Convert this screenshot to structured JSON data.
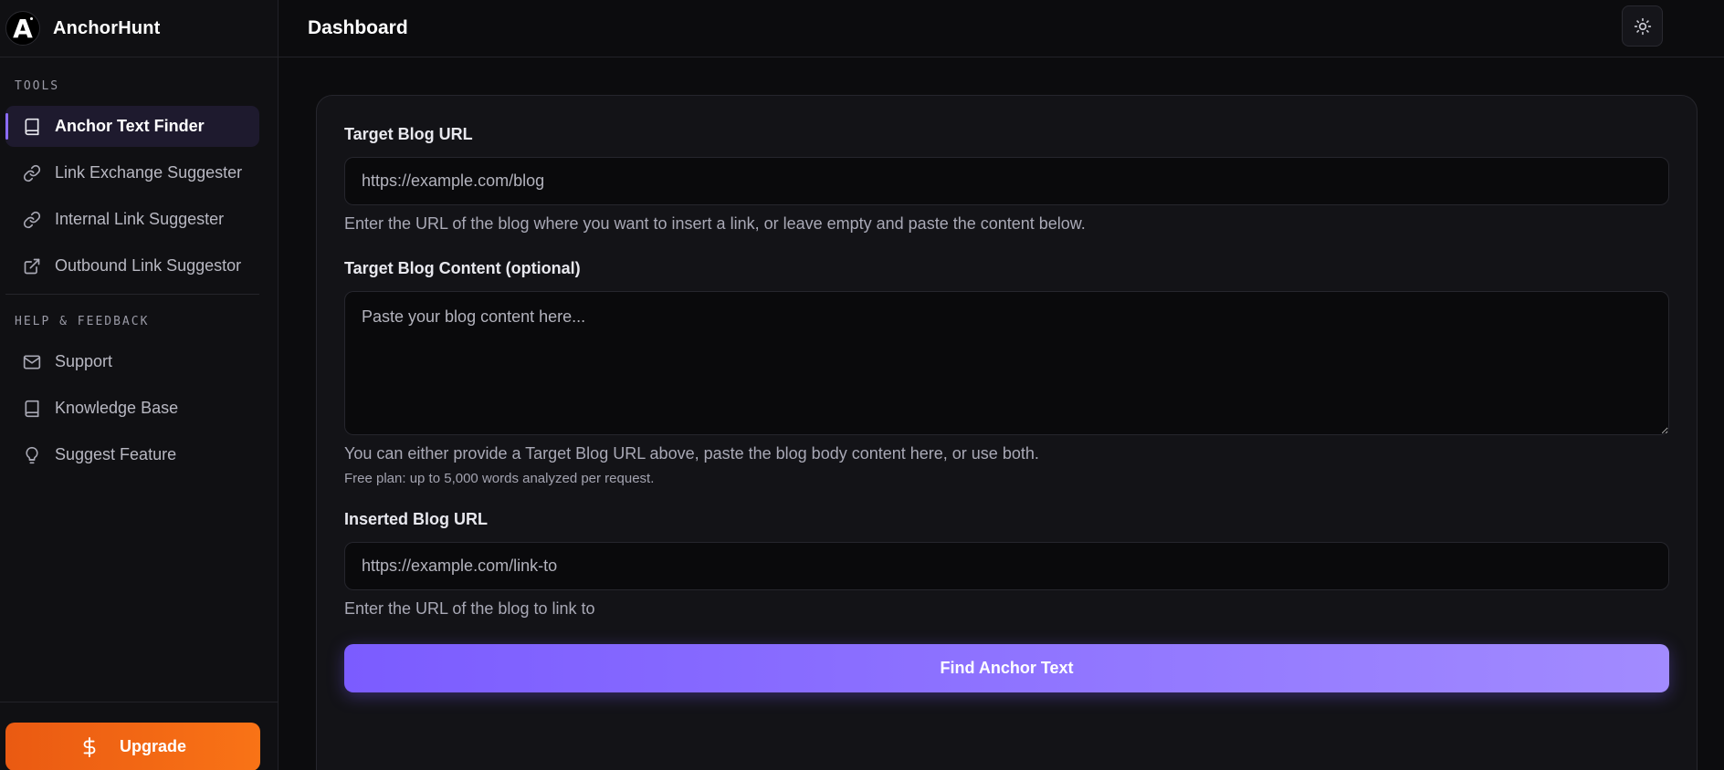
{
  "brand": {
    "logo_letter": "A",
    "name": "AnchorHunt"
  },
  "sidebar": {
    "tools_label": "TOOLS",
    "tools": [
      {
        "label": "Anchor Text Finder",
        "icon": "book-icon",
        "active": true
      },
      {
        "label": "Link Exchange Suggester",
        "icon": "link-icon",
        "active": false
      },
      {
        "label": "Internal Link Suggester",
        "icon": "link-icon",
        "active": false
      },
      {
        "label": "Outbound Link Suggestor",
        "icon": "external-link-icon",
        "active": false
      }
    ],
    "help_label": "HELP & FEEDBACK",
    "help": [
      {
        "label": "Support",
        "icon": "mail-icon"
      },
      {
        "label": "Knowledge Base",
        "icon": "book-icon"
      },
      {
        "label": "Suggest Feature",
        "icon": "lightbulb-icon"
      }
    ],
    "upgrade_label": "Upgrade",
    "upgrade_icon": "dollar-icon"
  },
  "header": {
    "title": "Dashboard",
    "theme_icon": "sun-icon"
  },
  "form": {
    "target_url": {
      "label": "Target Blog URL",
      "placeholder": "https://example.com/blog",
      "value": "",
      "help": "Enter the URL of the blog where you want to insert a link, or leave empty and paste the content below."
    },
    "target_content": {
      "label": "Target Blog Content (optional)",
      "placeholder": "Paste your blog content here...",
      "value": "",
      "help": "You can either provide a Target Blog URL above, paste the blog body content here, or use both.",
      "limit_note": "Free plan: up to 5,000 words analyzed per request."
    },
    "inserted_url": {
      "label": "Inserted Blog URL",
      "placeholder": "https://example.com/link-to",
      "value": "",
      "help": "Enter the URL of the blog to link to"
    },
    "submit_label": "Find Anchor Text"
  },
  "colors": {
    "accent": "#8b6cff",
    "button_gradient_start": "#7b5cff",
    "button_gradient_end": "#a28bff",
    "upgrade_start": "#ea5a12",
    "upgrade_end": "#f97316",
    "background": "#0b0b0d"
  }
}
